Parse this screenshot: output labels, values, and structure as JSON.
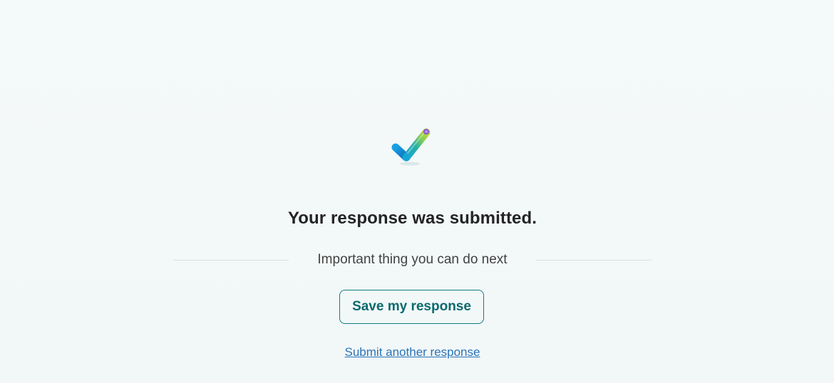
{
  "confirmation": {
    "icon": "checkmark-icon",
    "title": "Your response was submitted.",
    "next_steps_label": "Important thing you can do next",
    "save_button_label": "Save my response",
    "submit_another_label": "Submit another response"
  },
  "colors": {
    "accent": "#0f7d80",
    "link": "#2a73b8",
    "title_text": "#242424",
    "background": "#f4f9f9"
  }
}
